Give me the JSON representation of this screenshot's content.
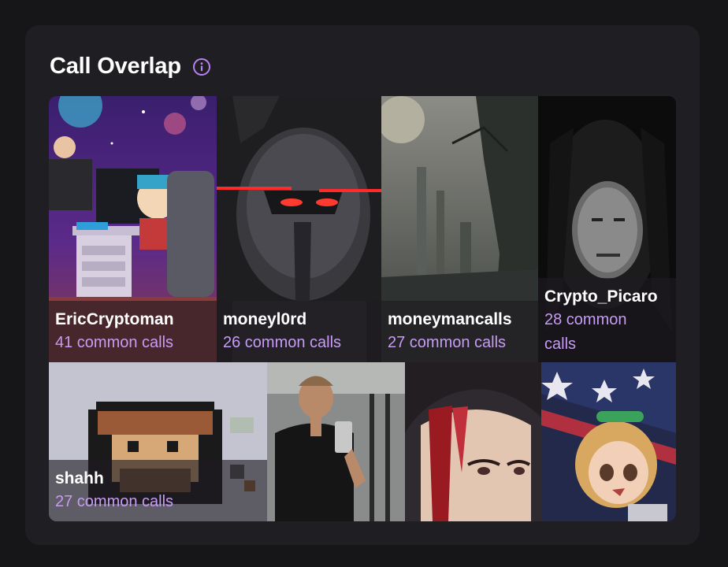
{
  "header": {
    "title": "Call Overlap",
    "info_icon": "info-circle-icon",
    "accent_color": "#b983f0"
  },
  "tiles": [
    {
      "name": "EricCryptoman",
      "count": "41 common calls"
    },
    {
      "name": "moneyl0rd",
      "count": "26 common calls"
    },
    {
      "name": "moneymancalls",
      "count": "27 common calls"
    },
    {
      "name": "Crypto_Picaro",
      "count_line1": "28 common",
      "count_line2": "calls"
    },
    {
      "name": "shahh",
      "count": "27 common calls"
    },
    {
      "name": "",
      "count": ""
    },
    {
      "name": "",
      "count": ""
    },
    {
      "name": "",
      "count": ""
    }
  ]
}
